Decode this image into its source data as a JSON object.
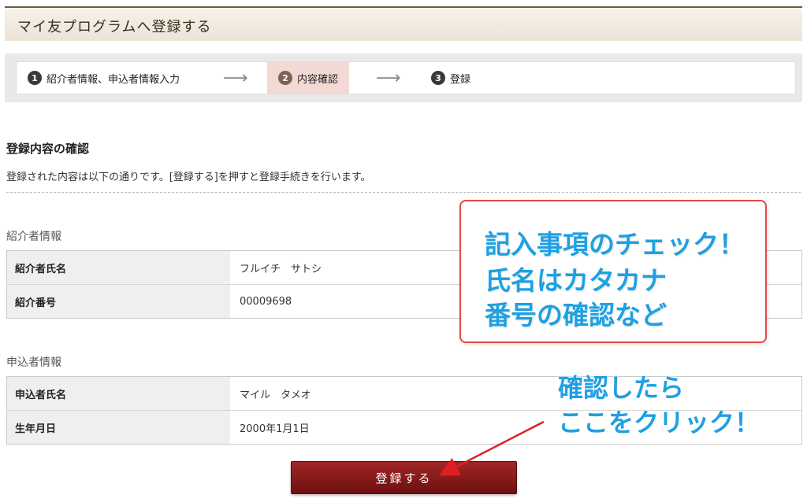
{
  "header": {
    "title": "マイ友プログラムへ登録する"
  },
  "steps": [
    {
      "num": "1",
      "label": "紹介者情報、申込者情報入力"
    },
    {
      "num": "2",
      "label": "内容確認"
    },
    {
      "num": "3",
      "label": "登録"
    }
  ],
  "step_arrow": "⟶",
  "confirm": {
    "title": "登録内容の確認",
    "description": "登録された内容は以下の通りです。[登録する]を押すと登録手続きを行います。"
  },
  "referrer": {
    "title": "紹介者情報",
    "rows": [
      {
        "label": "紹介者氏名",
        "value": "フルイチ　サトシ"
      },
      {
        "label": "紹介番号",
        "value": "00009698"
      }
    ]
  },
  "applicant": {
    "title": "申込者情報",
    "rows": [
      {
        "label": "申込者氏名",
        "value": "マイル　タメオ"
      },
      {
        "label": "生年月日",
        "value": "2000年1月1日"
      }
    ]
  },
  "submit_label": "登録する",
  "annotations": {
    "callout_lines": [
      "記入事項のチェック！",
      "氏名はカタカナ",
      "番号の確認など"
    ],
    "click_lines": [
      "確認したら",
      "ここをクリック！"
    ]
  },
  "colors": {
    "accent": "#8b1a1a",
    "annotation_text": "#1ea0e2",
    "annotation_border": "#e04848",
    "active_step": "#f3d9d4"
  }
}
